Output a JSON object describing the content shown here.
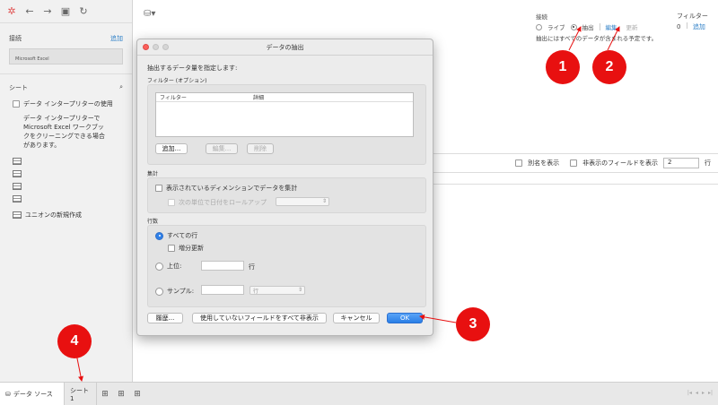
{
  "sidebar": {
    "connections_label": "接続",
    "add_label": "追加",
    "connection_name": "Microsoft Excel",
    "sheets_label": "シート",
    "use_interpreter_label": "データ インタープリターの使用",
    "interpreter_desc": "データ インタープリターで Microsoft Excel ワークブックをクリーニングできる場合があります。",
    "new_union_label": "ユニオンの新規作成"
  },
  "connection_panel": {
    "title": "接続",
    "live_label": "ライブ",
    "extract_label": "抽出",
    "edit_label": "編集",
    "refresh_label": "更新",
    "note": "抽出にはすべてのデータが含まれる予定です。"
  },
  "filter_panel": {
    "title": "フィルター",
    "count": "0",
    "add_label": "追加"
  },
  "grid_bar": {
    "show_alias_label": "別名を表示",
    "show_hidden_label": "非表示のフィールドを表示",
    "rows_value": "2",
    "rows_unit": "行"
  },
  "dialog": {
    "title": "データの抽出",
    "prompt": "抽出するデータ量を指定します:",
    "filters_label": "フィルター (オプション)",
    "col_filter": "フィルター",
    "col_detail": "詳細",
    "add_btn": "追加...",
    "edit_btn": "編集...",
    "delete_btn": "削除",
    "aggregate_label": "集計",
    "aggregate_visible_label": "表示されているディメンションでデータを集計",
    "rollup_label": "次の単位で日付をロールアップ",
    "rows_label": "行数",
    "all_rows_label": "すべての行",
    "incremental_label": "増分更新",
    "top_label": "上位:",
    "top_unit": "行",
    "sample_label": "サンプル:",
    "sample_unit": "行",
    "history_btn": "履歴...",
    "hide_unused_btn": "使用していないフィールドをすべて非表示",
    "cancel_btn": "キャンセル",
    "ok_btn": "OK"
  },
  "bottom": {
    "datasource_tab": "データ ソース",
    "sheet_tab": "シート 1"
  },
  "callouts": [
    "1",
    "2",
    "3",
    "4"
  ],
  "colors": {
    "accent": "#2f80c7",
    "callout": "#e81010",
    "primary_btn": "#2a7ee6"
  }
}
